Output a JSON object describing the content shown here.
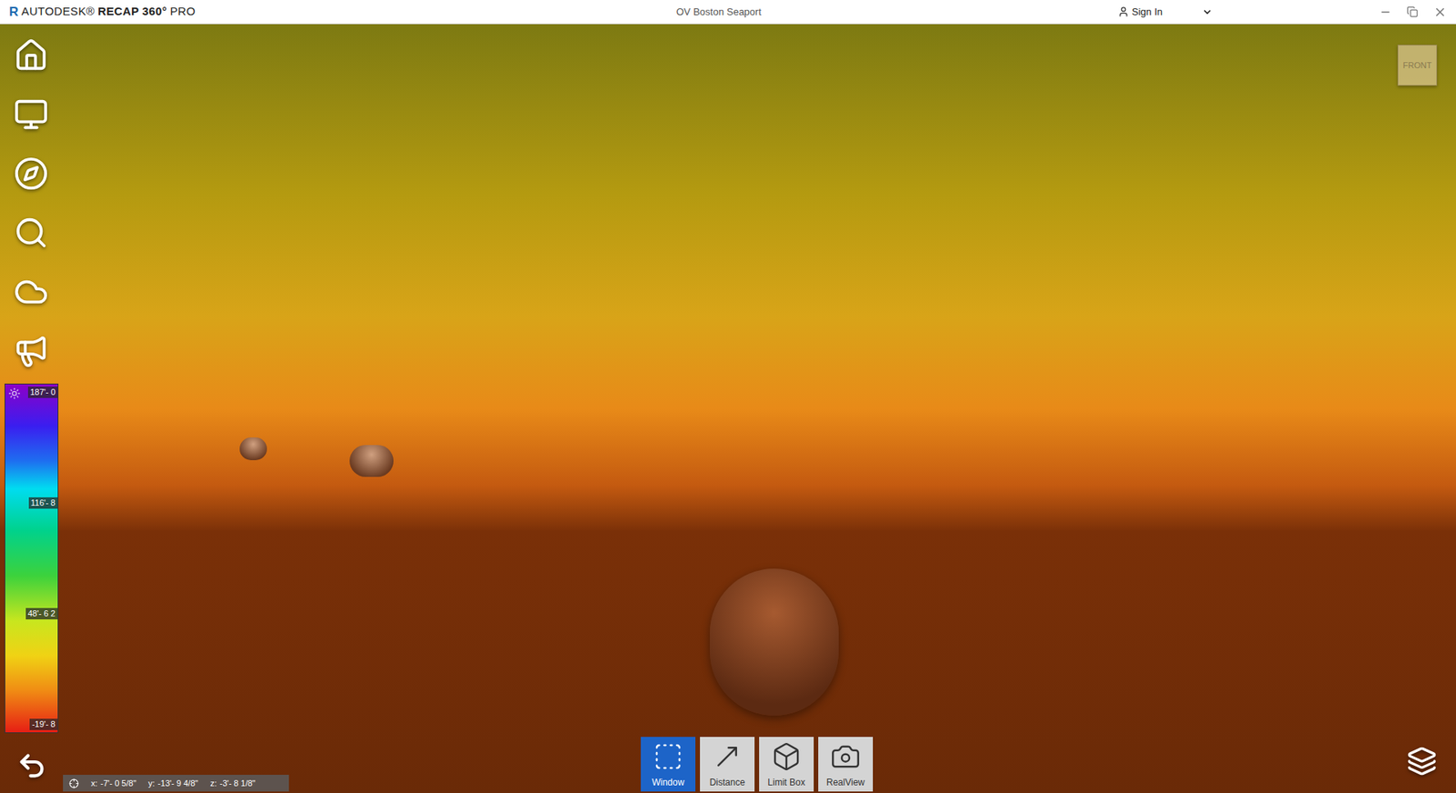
{
  "window": {
    "logo_mark": "R",
    "brand": "AUTODESK®",
    "product": "RECAP 360°",
    "edition": "PRO",
    "title": "OV Boston Seaport",
    "sign_in": "Sign In"
  },
  "view_cube": {
    "face": "FRONT"
  },
  "legend": {
    "labels": [
      "187'- 0",
      "116'- 8",
      "48'- 6 2",
      "-19'- 8"
    ]
  },
  "coordinates": [
    {
      "axis": "x:",
      "value": "-7'- 0 5/8\""
    },
    {
      "axis": "y:",
      "value": "-13'- 9 4/8\""
    },
    {
      "axis": "z:",
      "value": "-3'- 8 1/8\""
    }
  ],
  "tools": [
    {
      "label": "Window",
      "selected": true
    },
    {
      "label": "Distance",
      "selected": false
    },
    {
      "label": "Limit Box",
      "selected": false
    },
    {
      "label": "RealView",
      "selected": false
    }
  ]
}
